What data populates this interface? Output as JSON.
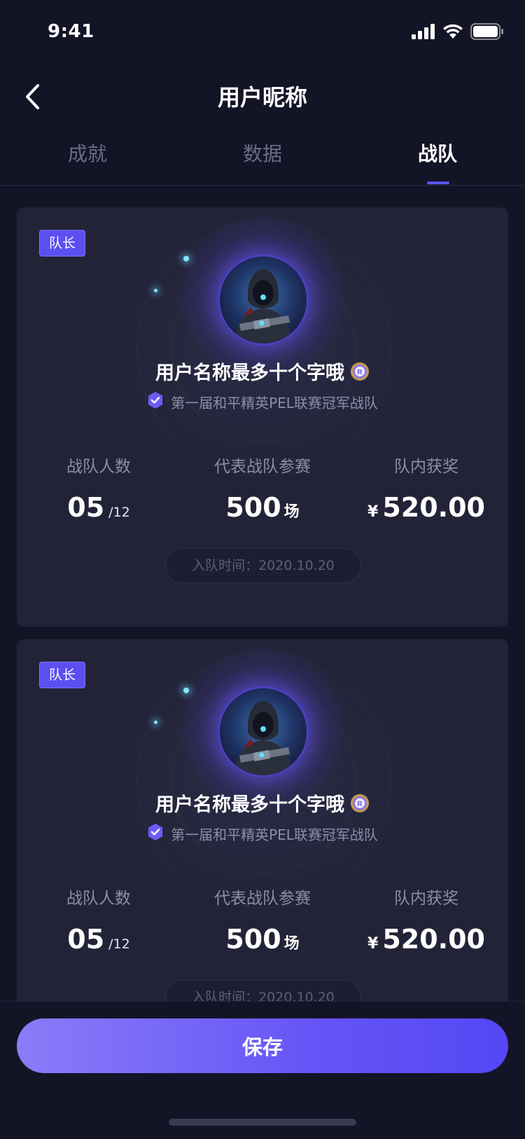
{
  "status_bar": {
    "time": "9:41",
    "icons": [
      "signal-icon",
      "wifi-icon",
      "battery-icon"
    ]
  },
  "nav": {
    "title": "用户昵称",
    "back_icon": "chevron-left-icon"
  },
  "tabs": [
    {
      "label": "成就",
      "active": false
    },
    {
      "label": "数据",
      "active": false
    },
    {
      "label": "战队",
      "active": true
    }
  ],
  "teams": [
    {
      "role_badge": "队长",
      "user_name": "用户名称最多十个字哦",
      "rank_icon": "rank-medal-icon",
      "honor_icon": "verified-shield-icon",
      "honor": "第一届和平精英PEL联赛冠军战队",
      "stats": {
        "members": {
          "label": "战队人数",
          "value": "05",
          "total": "/12"
        },
        "matches": {
          "label": "代表战队参赛",
          "value": "500",
          "unit": "场"
        },
        "prize": {
          "label": "队内获奖",
          "currency": "¥",
          "value": "520.00"
        }
      },
      "join_time": "入队时间：2020.10.20"
    },
    {
      "role_badge": "队长",
      "user_name": "用户名称最多十个字哦",
      "rank_icon": "rank-medal-icon",
      "honor_icon": "verified-shield-icon",
      "honor": "第一届和平精英PEL联赛冠军战队",
      "stats": {
        "members": {
          "label": "战队人数",
          "value": "05",
          "total": "/12"
        },
        "matches": {
          "label": "代表战队参赛",
          "value": "500",
          "unit": "场"
        },
        "prize": {
          "label": "队内获奖",
          "currency": "¥",
          "value": "520.00"
        }
      },
      "join_time": "入队时间：2020.10.20"
    }
  ],
  "save_button": {
    "label": "保存"
  },
  "colors": {
    "background": "#141427",
    "card": "#232338",
    "accent": "#5b4ff2",
    "muted_text": "#8d8daa"
  }
}
